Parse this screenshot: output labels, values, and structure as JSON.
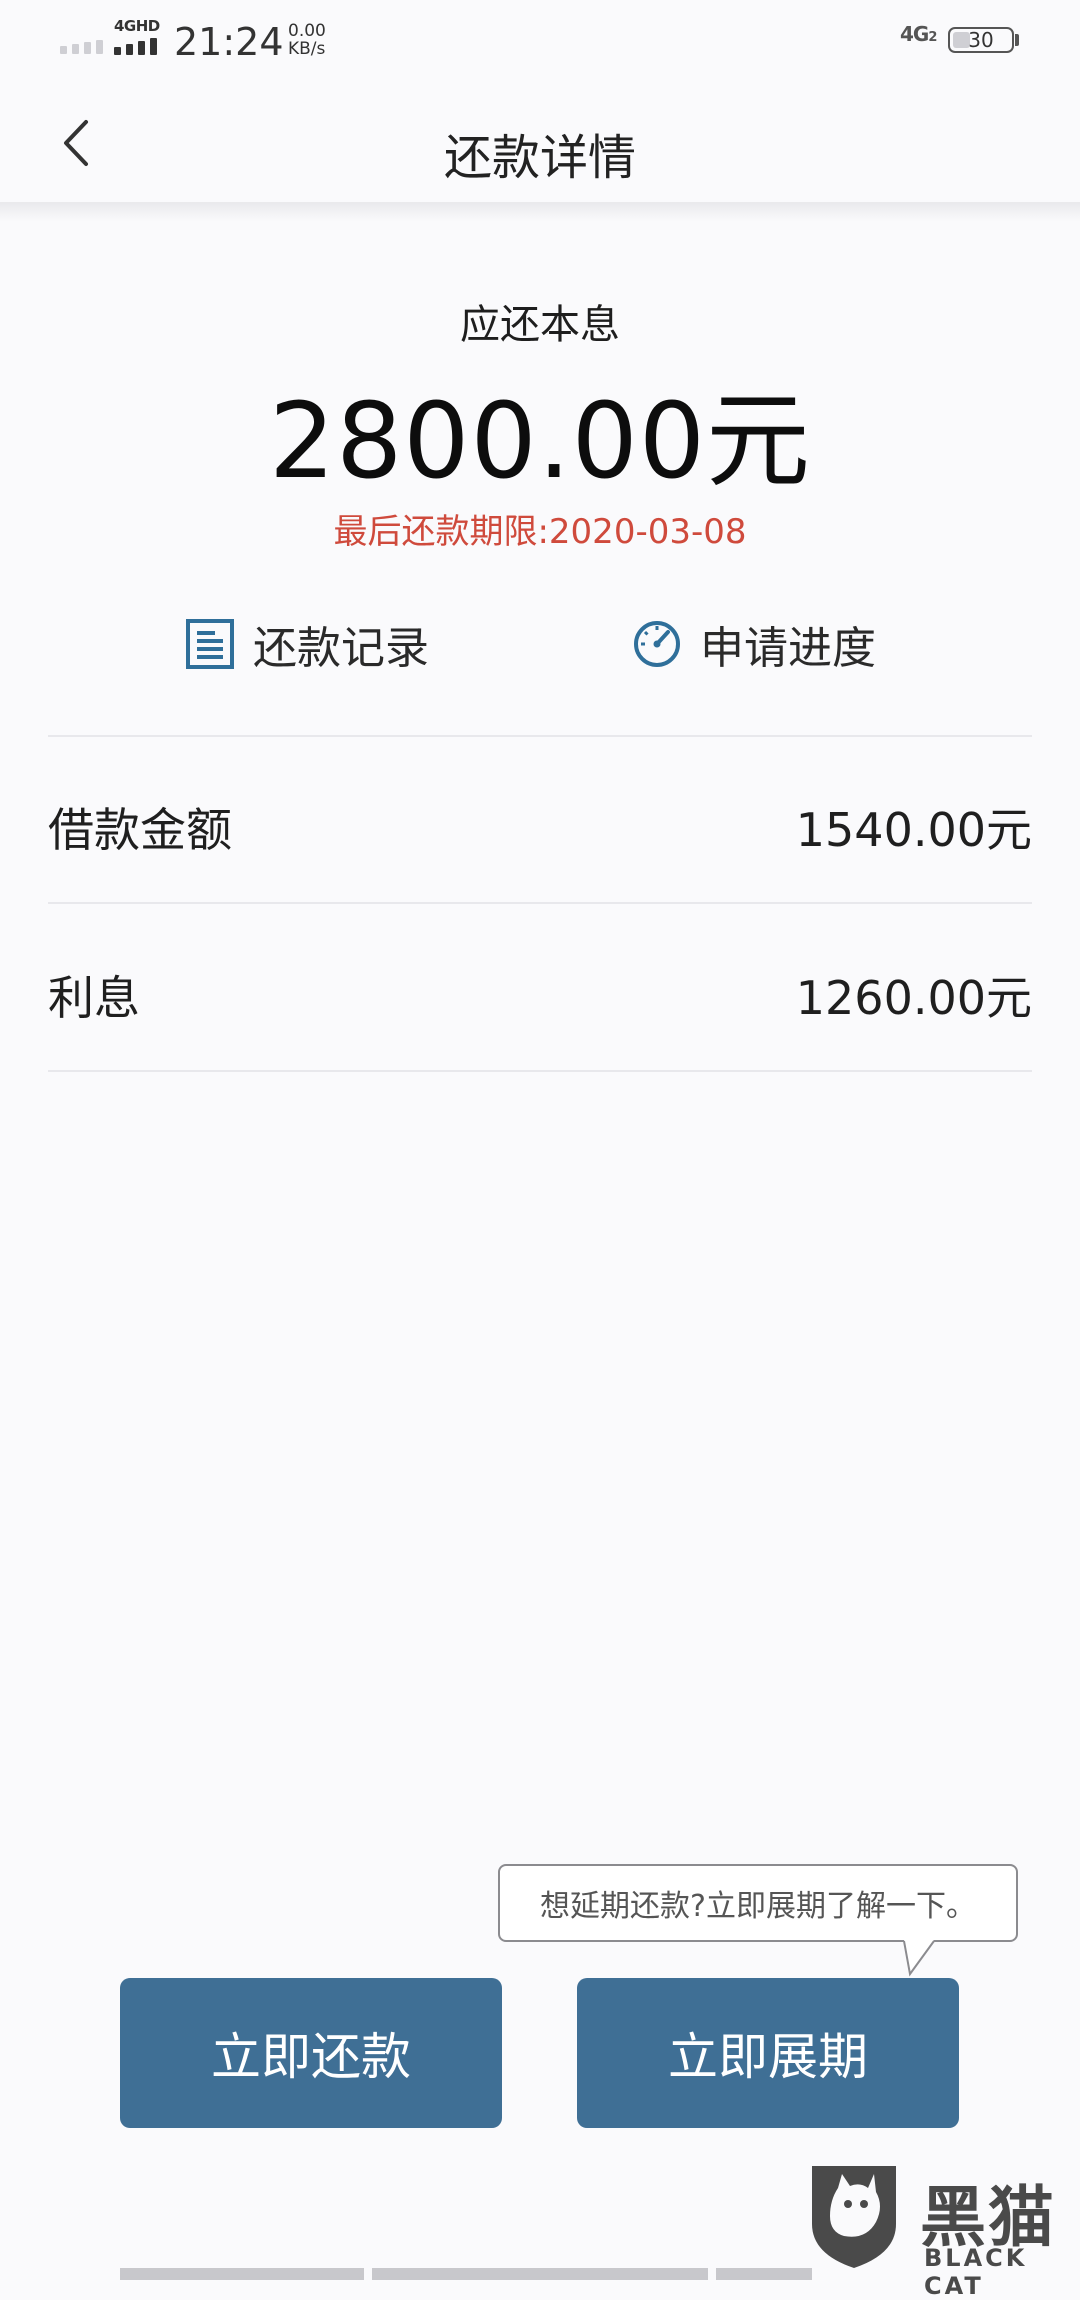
{
  "status_bar": {
    "network_label": "4GHD",
    "time": "21:24",
    "speed_value": "0.00",
    "speed_unit": "KB/s",
    "network_right": "4G",
    "network_right_sub": "2",
    "battery": "30"
  },
  "header": {
    "title": "还款详情",
    "back_icon": "chevron-left-icon"
  },
  "summary": {
    "label": "应还本息",
    "amount": "2800.00元",
    "deadline": "最后还款期限:2020-03-08"
  },
  "quick_links": [
    {
      "label": "还款记录",
      "icon": "document-icon"
    },
    {
      "label": "申请进度",
      "icon": "gauge-icon"
    }
  ],
  "details": [
    {
      "label": "借款金额",
      "value": "1540.00元"
    },
    {
      "label": "利息",
      "value": "1260.00元"
    }
  ],
  "tooltip": {
    "text": "想延期还款?立即展期了解一下。"
  },
  "actions": {
    "repay": "立即还款",
    "extend": "立即展期"
  },
  "watermark": {
    "title": "黑猫",
    "subtitle": "BLACK CAT"
  },
  "colors": {
    "accent": "#3f6f95",
    "deadline": "#cf4a3c",
    "icon": "#2f6f9a"
  }
}
